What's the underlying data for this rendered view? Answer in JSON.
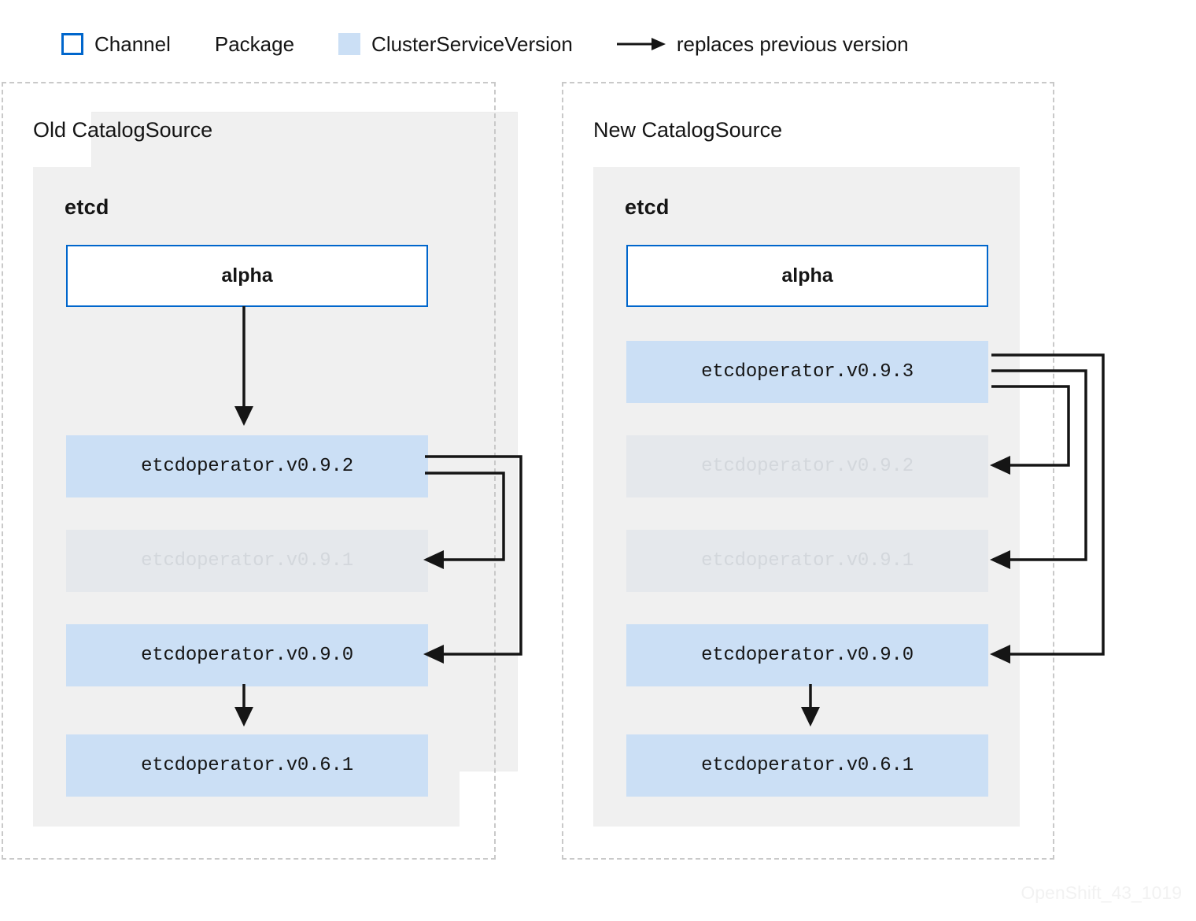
{
  "legend": {
    "items": [
      {
        "swatch": "channel-swatch",
        "label": "Channel"
      },
      {
        "swatch": "package-swatch",
        "label": "Package"
      },
      {
        "swatch": "clusterserviceversion-swatch",
        "label": "ClusterServiceVersion"
      },
      {
        "swatch": "arrow-swatch",
        "label": "replaces previous version"
      }
    ]
  },
  "colors": {
    "channel_border": "#0066cc",
    "package_fill": "#f0f0f0",
    "csv_fill": "#cbdff5",
    "csv_faded_fill": "#e5e8ec",
    "csv_faded_text": "#d3d7dc",
    "arrow": "#151515",
    "dashed_border": "#c9c9c9",
    "watermark": "#f2f2f2"
  },
  "catalogs": [
    {
      "title": "Old CatalogSource",
      "package": {
        "name": "etcd",
        "channel": "alpha",
        "csvs": [
          {
            "label": "etcdoperator.v0.9.2",
            "faded": false
          },
          {
            "label": "etcdoperator.v0.9.1",
            "faded": true
          },
          {
            "label": "etcdoperator.v0.9.0",
            "faded": false
          },
          {
            "label": "etcdoperator.v0.6.1",
            "faded": false
          }
        ]
      }
    },
    {
      "title": "New CatalogSource",
      "package": {
        "name": "etcd",
        "channel": "alpha",
        "csvs": [
          {
            "label": "etcdoperator.v0.9.3",
            "faded": false
          },
          {
            "label": "etcdoperator.v0.9.2",
            "faded": true
          },
          {
            "label": "etcdoperator.v0.9.1",
            "faded": true
          },
          {
            "label": "etcdoperator.v0.9.0",
            "faded": false
          },
          {
            "label": "etcdoperator.v0.6.1",
            "faded": false
          }
        ]
      }
    }
  ],
  "relationships": {
    "old": [
      {
        "from": "alpha",
        "to": "etcdoperator.v0.9.2",
        "kind": "channel-head"
      },
      {
        "from": "etcdoperator.v0.9.2",
        "to": "etcdoperator.v0.9.1",
        "kind": "replaces"
      },
      {
        "from": "etcdoperator.v0.9.2",
        "to": "etcdoperator.v0.9.0",
        "kind": "replaces"
      },
      {
        "from": "etcdoperator.v0.9.0",
        "to": "etcdoperator.v0.6.1",
        "kind": "replaces"
      }
    ],
    "new": [
      {
        "from": "etcdoperator.v0.9.3",
        "to": "etcdoperator.v0.9.2",
        "kind": "replaces"
      },
      {
        "from": "etcdoperator.v0.9.3",
        "to": "etcdoperator.v0.9.1",
        "kind": "replaces"
      },
      {
        "from": "etcdoperator.v0.9.3",
        "to": "etcdoperator.v0.9.0",
        "kind": "replaces"
      },
      {
        "from": "etcdoperator.v0.9.0",
        "to": "etcdoperator.v0.6.1",
        "kind": "replaces"
      }
    ]
  },
  "watermark": "OpenShift_43_1019"
}
